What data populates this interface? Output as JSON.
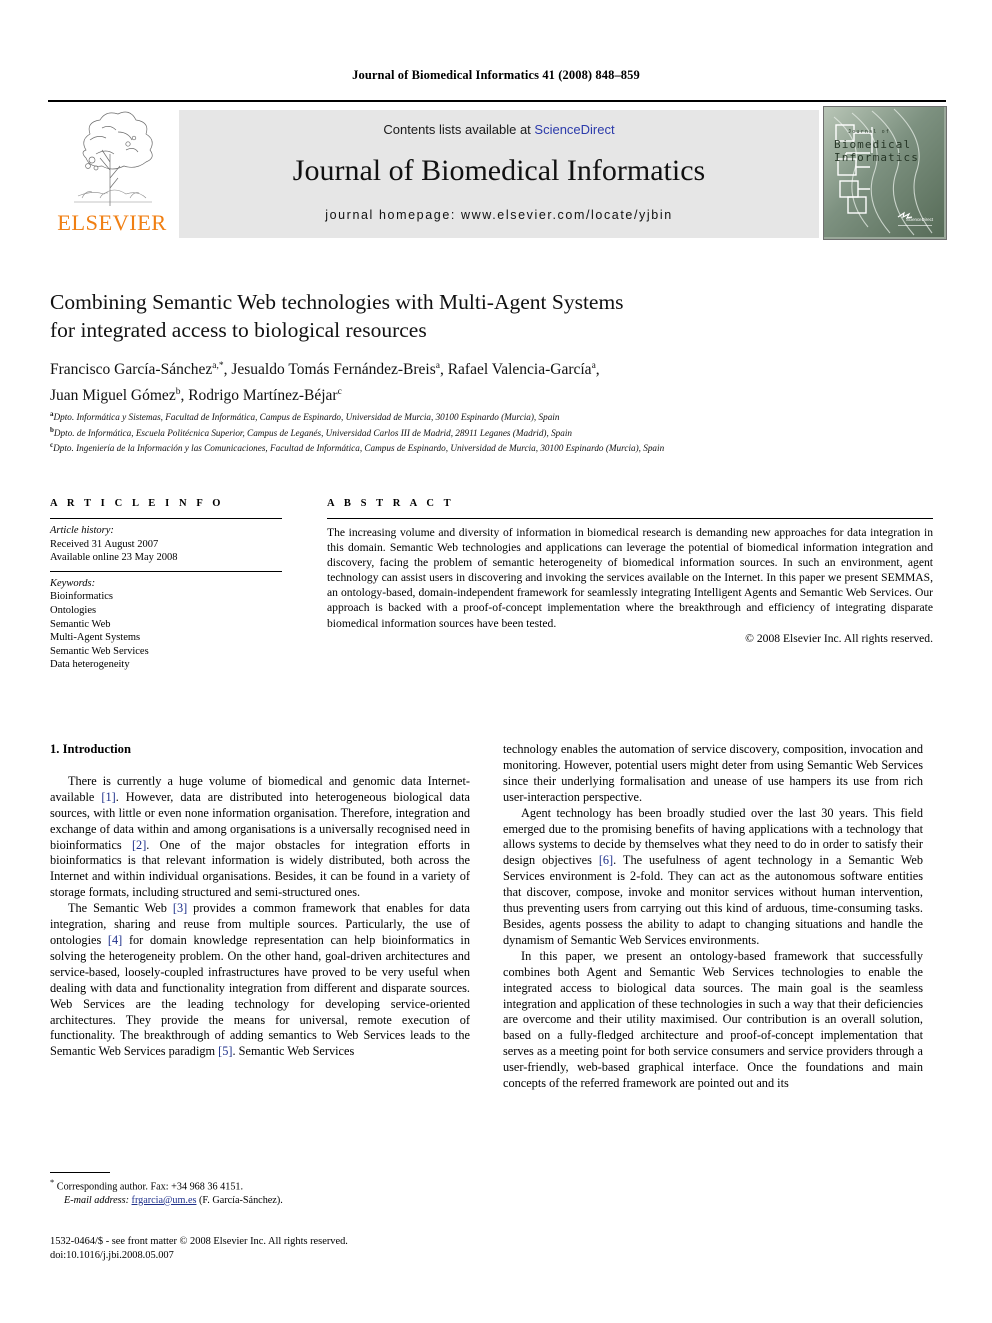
{
  "running_head": "Journal of Biomedical Informatics 41 (2008) 848–859",
  "masthead": {
    "publisher_name": "ELSEVIER",
    "contents_prefix": "Contents lists available at ",
    "contents_link": "ScienceDirect",
    "journal_title": "Journal of Biomedical Informatics",
    "homepage": "journal homepage: www.elsevier.com/locate/yjbin",
    "cover_line1": "Journal of",
    "cover_line2": "Biomedical",
    "cover_line3": "Informatics",
    "cover_badge": "ScienceDirect"
  },
  "article": {
    "title_line1": "Combining Semantic Web technologies with Multi-Agent Systems",
    "title_line2": "for integrated access to biological resources",
    "authors_line1": "Francisco García-Sánchez",
    "authors_line1_sup": "a,*",
    "authors_line1_b": ", Jesualdo Tomás Fernández-Breis",
    "authors_line1_sup2": "a",
    "authors_line1_c": ", Rafael Valencia-García",
    "authors_line1_sup3": "a",
    "authors_line1_d": ",",
    "authors_line2": "Juan Miguel Gómez",
    "authors_line2_sup": "b",
    "authors_line2_b": ", Rodrigo Martínez-Béjar",
    "authors_line2_sup2": "c",
    "affiliations": [
      {
        "marker": "a",
        "text": "Dpto. Informática y Sistemas, Facultad de Informática, Campus de Espinardo, Universidad de Murcia, 30100 Espinardo (Murcia), Spain"
      },
      {
        "marker": "b",
        "text": "Dpto. de Informática, Escuela Politécnica Superior, Campus de Leganés, Universidad Carlos III de Madrid, 28911 Leganes (Madrid), Spain"
      },
      {
        "marker": "c",
        "text": "Dpto. Ingeniería de la Información y las Comunicaciones, Facultad de Informática, Campus de Espinardo, Universidad de Murcia, 30100 Espinardo (Murcia), Spain"
      }
    ]
  },
  "info": {
    "heading": "A R T I C L E    I N F O",
    "history_label": "Article history:",
    "history_lines": [
      "Received 31 August 2007",
      "Available online 23 May 2008"
    ],
    "keywords_label": "Keywords:",
    "keywords": [
      "Bioinformatics",
      "Ontologies",
      "Semantic Web",
      "Multi-Agent Systems",
      "Semantic Web Services",
      "Data heterogeneity"
    ]
  },
  "abstract": {
    "heading": "A B S T R A C T",
    "text": "The increasing volume and diversity of information in biomedical research is demanding new approaches for data integration in this domain. Semantic Web technologies and applications can leverage the potential of biomedical information integration and discovery, facing the problem of semantic heterogeneity of biomedical information sources. In such an environment, agent technology can assist users in discovering and invoking the services available on the Internet. In this paper we present SEMMAS, an ontology-based, domain-independent framework for seamlessly integrating Intelligent Agents and Semantic Web Services. Our approach is backed with a proof-of-concept implementation where the breakthrough and efficiency of integrating disparate biomedical information sources have been tested.",
    "copyright": "© 2008 Elsevier Inc. All rights reserved."
  },
  "body": {
    "section_heading": "1. Introduction",
    "left_paragraphs": [
      {
        "segments": [
          {
            "t": "There is currently a huge volume of biomedical and genomic data Internet-available "
          },
          {
            "t": "[1]",
            "ref": true
          },
          {
            "t": ". However, data are distributed into heterogeneous biological data sources, with little or even none information organisation. Therefore, integration and exchange of data within and among organisations is a universally recognised need in bioinformatics "
          },
          {
            "t": "[2]",
            "ref": true
          },
          {
            "t": ". One of the major obstacles for integration efforts in bioinformatics is that relevant information is widely distributed, both across the Internet and within individual organisations. Besides, it can be found in a variety of storage formats, including structured and semi-structured ones."
          }
        ]
      },
      {
        "segments": [
          {
            "t": "The Semantic Web "
          },
          {
            "t": "[3]",
            "ref": true
          },
          {
            "t": " provides a common framework that enables for data integration, sharing and reuse from multiple sources. Particularly, the use of ontologies "
          },
          {
            "t": "[4]",
            "ref": true
          },
          {
            "t": " for domain knowledge representation can help bioinformatics in solving the heterogeneity problem. On the other hand, goal-driven architectures and service-based, loosely-coupled infrastructures have proved to be very useful when dealing with data and functionality integration from different and disparate sources. Web Services are the leading technology for developing service-oriented architectures. They provide the means for universal, remote execution of functionality. The breakthrough of adding semantics to Web Services leads to the Semantic Web Services paradigm "
          },
          {
            "t": "[5]",
            "ref": true
          },
          {
            "t": ". Semantic Web Services"
          }
        ]
      }
    ],
    "right_paragraphs": [
      {
        "segments": [
          {
            "t": "technology enables the automation of service discovery, composition, invocation and monitoring. However, potential users might deter from using Semantic Web Services since their underlying formalisation and unease of use hampers its use from rich user-interaction perspective."
          }
        ],
        "noindent": true
      },
      {
        "segments": [
          {
            "t": "Agent technology has been broadly studied over the last 30 years. This field emerged due to the promising benefits of having applications with a technology that allows systems to decide by themselves what they need to do in order to satisfy their design objectives "
          },
          {
            "t": "[6]",
            "ref": true
          },
          {
            "t": ". The usefulness of agent technology in a Semantic Web Services environment is 2-fold. They can act as the autonomous software entities that discover, compose, invoke and monitor services without human intervention, thus preventing users from carrying out this kind of arduous, time-consuming tasks. Besides, agents possess the ability to adapt to changing situations and handle the dynamism of Semantic Web Services environments."
          }
        ]
      },
      {
        "segments": [
          {
            "t": "In this paper, we present an ontology-based framework that successfully combines both Agent and Semantic Web Services technologies to enable the integrated access to biological data sources. The main goal is the seamless integration and application of these technologies in such a way that their deficiencies are overcome and their utility maximised. Our contribution is an overall solution, based on a fully-fledged architecture and proof-of-concept implementation that serves as a meeting point for both service consumers and service providers through a user-friendly, web-based graphical interface. Once the foundations and main concepts of the referred framework are pointed out and its"
          }
        ]
      }
    ]
  },
  "footnote": {
    "marker": "*",
    "corresponding": "Corresponding author. Fax: +34 968 36 4151.",
    "email_label": "E-mail address:",
    "email": "frgarcia@um.es",
    "email_suffix": " (F. García-Sánchez)."
  },
  "imprint": {
    "line1": "1532-0464/$ - see front matter © 2008 Elsevier Inc. All rights reserved.",
    "line2": "doi:10.1016/j.jbi.2008.05.007"
  },
  "colors": {
    "link": "#2c3bab",
    "reference": "#1d2f8a",
    "elsevier_orange": "#f07f13",
    "band_gray": "#e6e6e6"
  }
}
